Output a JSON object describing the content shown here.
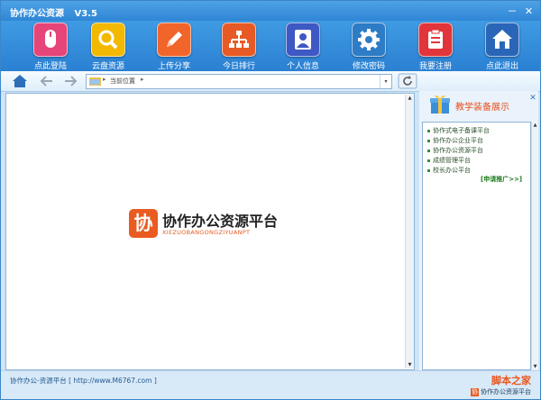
{
  "window": {
    "title": "协作办公资源",
    "version": "V3.5",
    "buttons": {
      "minimize": "－",
      "close": "✕"
    }
  },
  "toolbar": {
    "items": [
      {
        "label": "点此登陆",
        "icon": "mouse-icon",
        "color": "#e6457a"
      },
      {
        "label": "云盘资源",
        "icon": "search-icon",
        "color": "#f3b800"
      },
      {
        "label": "上传分享",
        "icon": "pencil-icon",
        "color": "#f2652a"
      },
      {
        "label": "今日排行",
        "icon": "sitemap-icon",
        "color": "#e85a25"
      },
      {
        "label": "个人信息",
        "icon": "user-icon",
        "color": "#3e58c4"
      },
      {
        "label": "修改密码",
        "icon": "gear-icon",
        "color": "#2e7cc6"
      },
      {
        "label": "我要注册",
        "icon": "clipboard-icon",
        "color": "#e2353b"
      },
      {
        "label": "点此退出",
        "icon": "home-icon",
        "color": "#2a66b8"
      }
    ]
  },
  "navbar": {
    "address_label": "当前位置",
    "separator": "▸",
    "dropdown": "▾"
  },
  "main": {
    "logo_mark": "协",
    "logo_cn": "协作办公资源平台",
    "logo_en": "XIEZUOBANGONGZIYUANPT"
  },
  "right_panel": {
    "title": "教学装备展示",
    "close": "✕",
    "items": [
      "协作式电子备课平台",
      "协作办公企业平台",
      "协作办公资源平台",
      "成绩管理平台",
      "校长办公平台"
    ],
    "link": "[申请推广>>]"
  },
  "status": {
    "left": "协作办公-资源平台 [ http://www.M6767.com ]",
    "watermark_top": "脚本之家",
    "watermark_bottom": "协作办公资源平台"
  },
  "colors": {
    "titlebar": "#2f86d6",
    "toolbar": "#2b80d2",
    "accent": "#e95b20"
  }
}
